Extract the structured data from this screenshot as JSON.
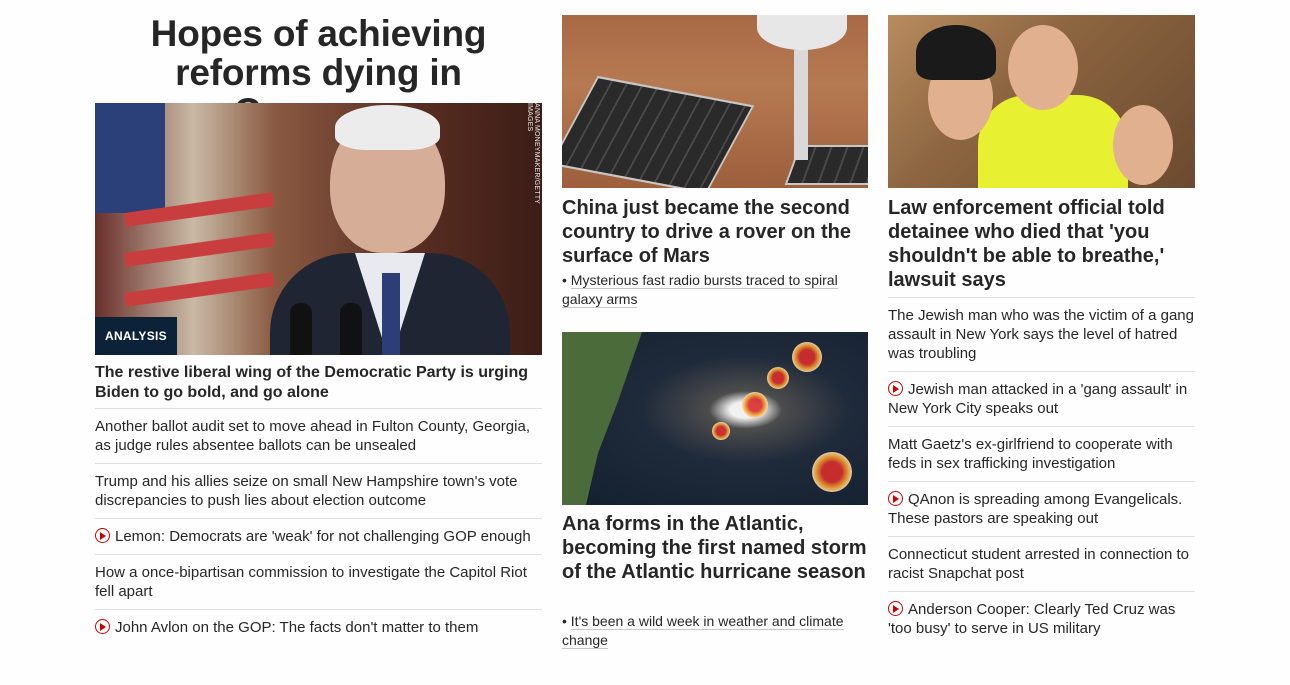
{
  "lead": {
    "headline": "Hopes of achieving reforms dying in Congress",
    "badge": "ANALYSIS",
    "photo_credit": "ANNA MONEYMAKER/GETTY IMAGES",
    "sub_headline": "The restive liberal wing of the Democratic Party is urging Biden to go bold, and go alone",
    "items": [
      {
        "text": "Another ballot audit set to move ahead in Fulton County, Georgia, as judge rules absentee ballots can be unsealed",
        "video": false
      },
      {
        "text": "Trump and his allies seize on small New Hampshire town's vote discrepancies to push lies about election outcome",
        "video": false
      },
      {
        "text": "Lemon: Democrats are 'weak' for not challenging GOP enough",
        "video": true
      },
      {
        "text": "How a once-bipartisan commission to investigate the Capitol Riot fell apart",
        "video": false
      },
      {
        "text": "John Avlon on the GOP: The facts don't matter to them",
        "video": true
      }
    ]
  },
  "mars": {
    "title": "China just became the second country to drive a rover on the surface of Mars",
    "related": "Mysterious fast radio bursts traced to spiral galaxy arms"
  },
  "storm": {
    "title": "Ana forms in the Atlantic, becoming the first named storm of the Atlantic hurricane season",
    "related": "It's been a wild week in weather and climate change"
  },
  "detainee": {
    "title": "Law enforcement official told detainee who died that 'you shouldn't be able to breathe,' lawsuit says",
    "items": [
      {
        "text": "The Jewish man who was the victim of a gang assault in New York says the level of hatred was troubling",
        "video": false
      },
      {
        "text": "Jewish man attacked in a 'gang assault' in New York City speaks out",
        "video": true
      },
      {
        "text": "Matt Gaetz's ex-girlfriend to cooperate with feds in sex trafficking investigation",
        "video": false
      },
      {
        "text": "QAnon is spreading among Evangelicals. These pastors are speaking out",
        "video": true
      },
      {
        "text": "Connecticut student arrested in connection to racist Snapchat post",
        "video": false
      },
      {
        "text": "Anderson Cooper: Clearly Ted Cruz was 'too busy' to serve in US military",
        "video": true
      }
    ]
  },
  "colors": {
    "text": "#262626",
    "video_icon": "#cc0000",
    "badge_bg": "#0c2238",
    "divider": "#e1e1e1"
  },
  "icons": {
    "video": "play-circle-icon"
  }
}
